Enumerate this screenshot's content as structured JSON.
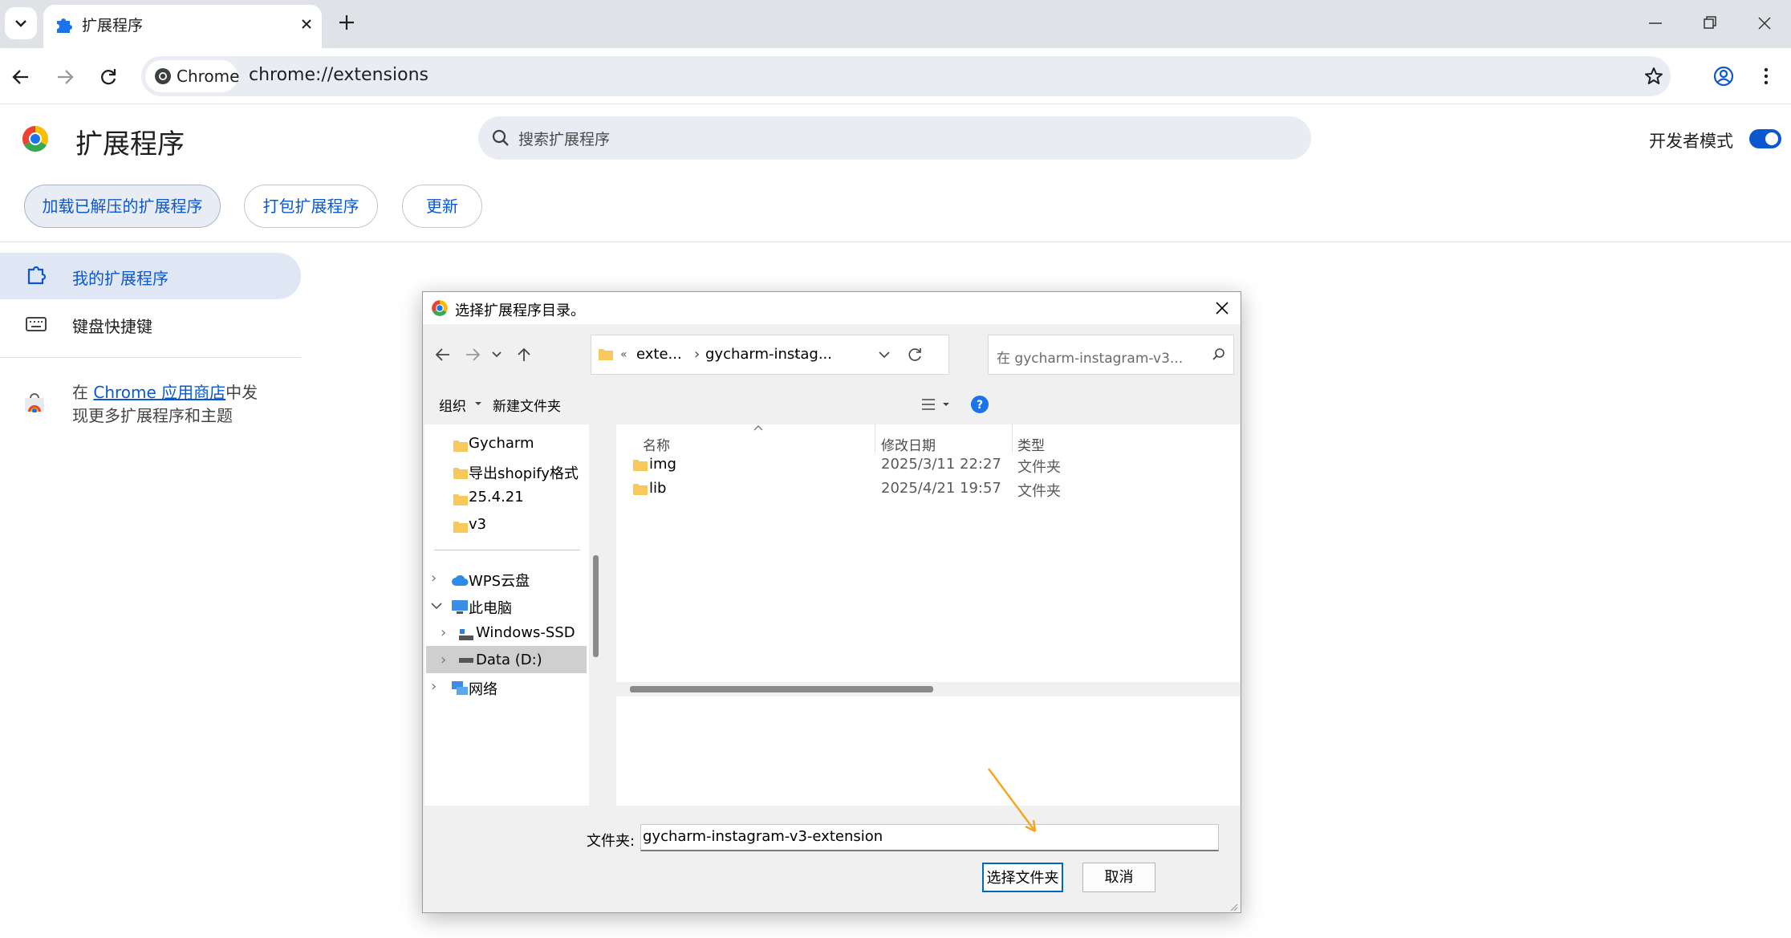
{
  "browser": {
    "tab_title": "扩展程序",
    "chip_label": "Chrome",
    "url": "chrome://extensions"
  },
  "page": {
    "title": "扩展程序",
    "search_placeholder": "搜索扩展程序",
    "dev_mode_label": "开发者模式",
    "dev_mode_on": true,
    "buttons": {
      "load_unpacked": "加载已解压的扩展程序",
      "pack": "打包扩展程序",
      "update": "更新"
    },
    "sidebar": {
      "my_extensions": "我的扩展程序",
      "shortcuts": "键盘快捷键",
      "promo_prefix": "在 ",
      "promo_link": "Chrome 应用商店",
      "promo_suffix": "中发",
      "promo_line2": "现更多扩展程序和主题"
    }
  },
  "dialog": {
    "title": "选择扩展程序目录。",
    "breadcrumb": [
      "«",
      "exte...",
      "gycharm-instag..."
    ],
    "search_placeholder": "在 gycharm-instagram-v3...",
    "organize": "组织",
    "new_folder": "新建文件夹",
    "nav_tree": [
      "Gycharm",
      "导出shopify格式",
      "25.4.21",
      "v3",
      "WPS云盘",
      "此电脑",
      "Windows-SSD",
      "Data (D:)",
      "网络"
    ],
    "columns": {
      "name": "名称",
      "date": "修改日期",
      "type": "类型"
    },
    "files": [
      {
        "name": "img",
        "date": "2025/3/11 22:27",
        "type": "文件夹"
      },
      {
        "name": "lib",
        "date": "2025/4/21 19:57",
        "type": "文件夹"
      }
    ],
    "folder_label": "文件夹:",
    "folder_value": "gycharm-instagram-v3-extension",
    "select_button": "选择文件夹",
    "cancel_button": "取消"
  },
  "colors": {
    "accent": "#0b57d0",
    "arrow": "#f5a623"
  }
}
